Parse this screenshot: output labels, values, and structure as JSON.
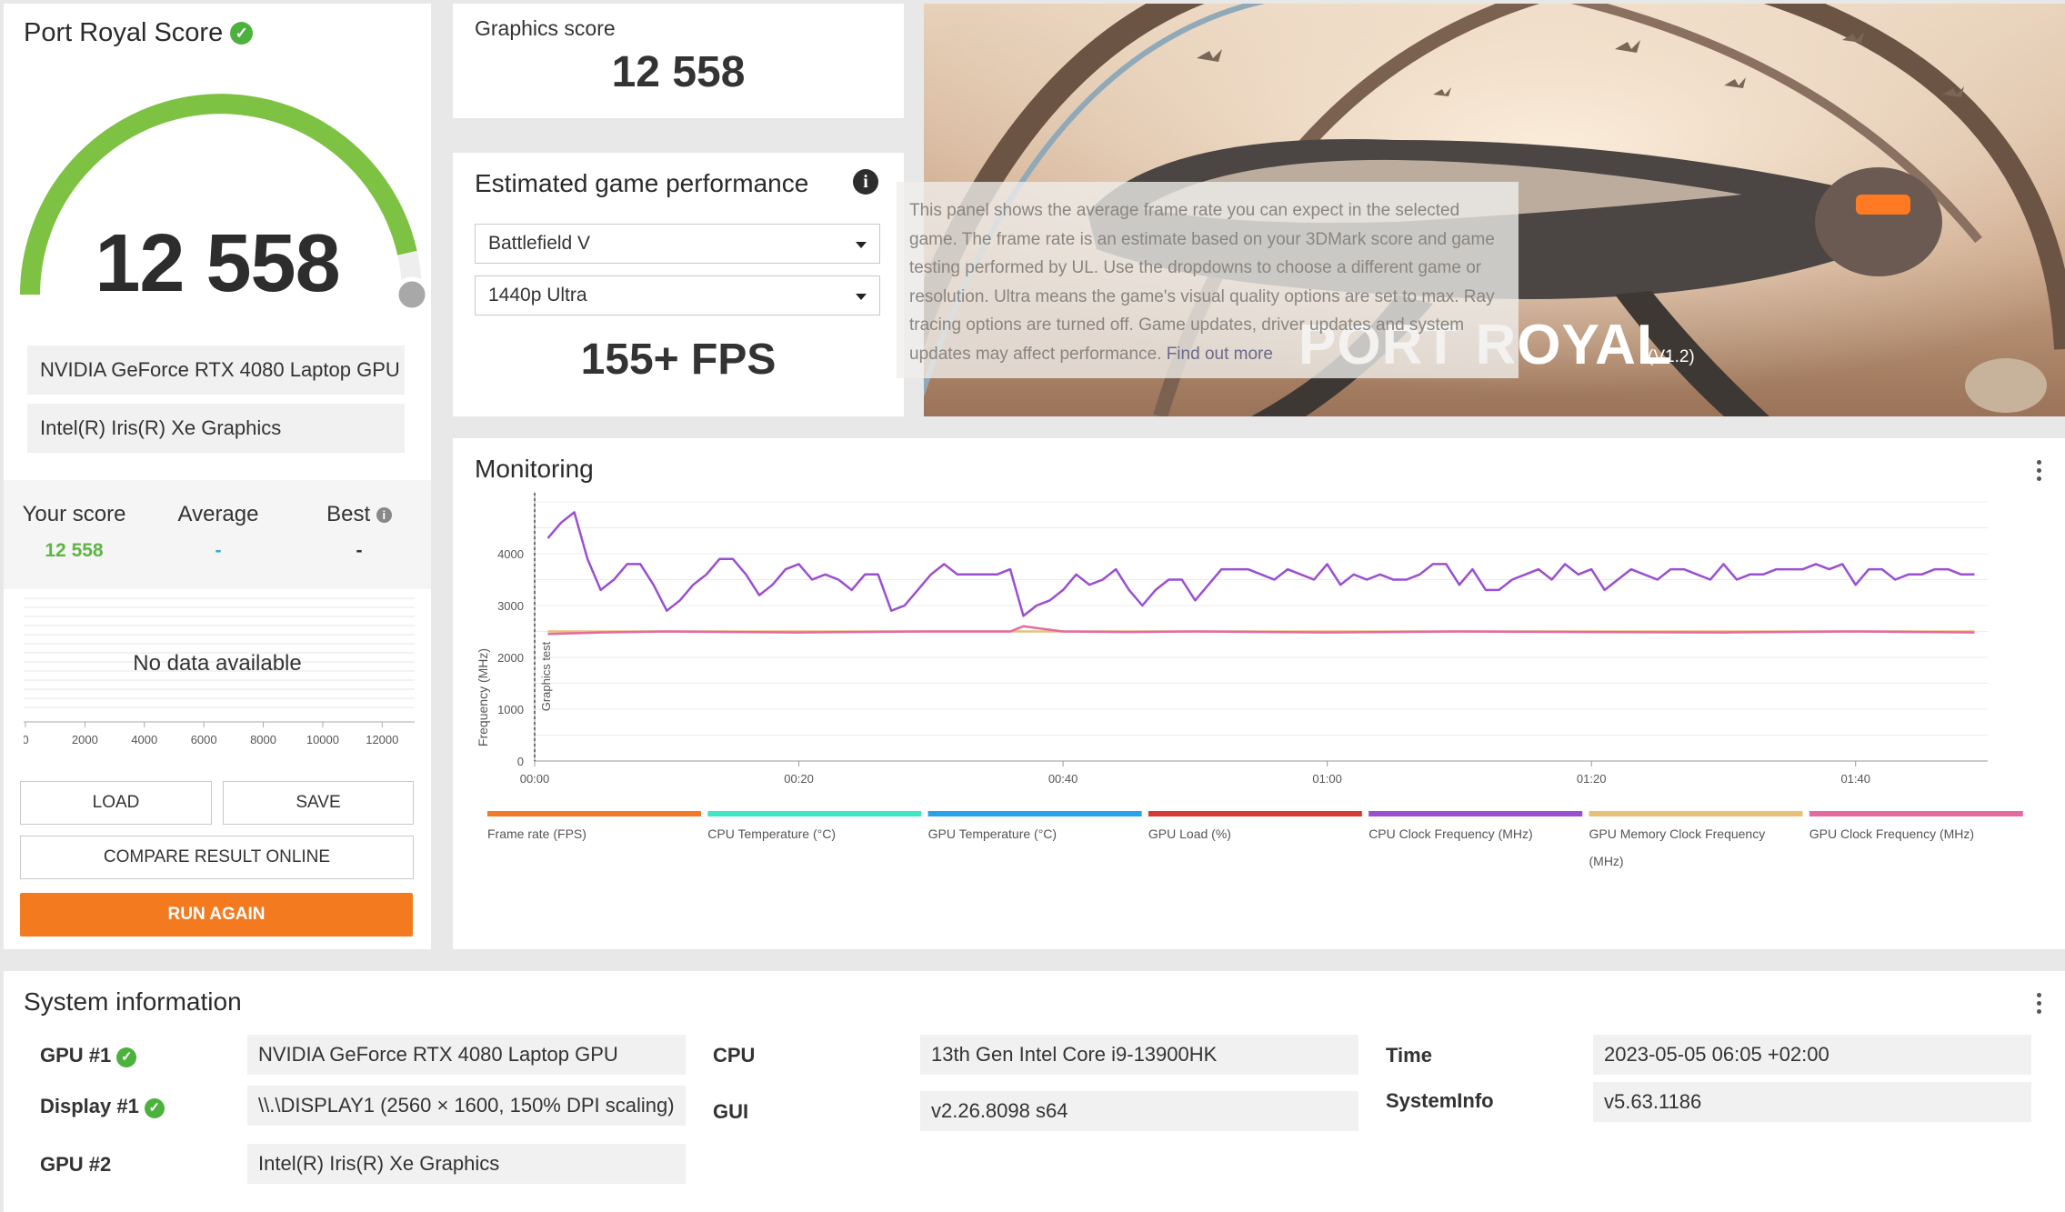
{
  "score_card": {
    "title": "Port Royal Score",
    "score": "12 558",
    "score_value": 12558,
    "gauge_fraction": 0.93,
    "gpus": [
      "NVIDIA GeForce RTX 4080 Laptop GPU",
      "Intel(R) Iris(R) Xe Graphics"
    ],
    "stats": {
      "your_label": "Your score",
      "your_value": "12 558",
      "avg_label": "Average",
      "avg_value": "-",
      "best_label": "Best",
      "best_value": "-"
    },
    "no_data": "No data available",
    "axis_ticks": [
      "0",
      "2000",
      "4000",
      "6000",
      "8000",
      "10000",
      "12000"
    ],
    "load_label": "LOAD",
    "save_label": "SAVE",
    "compare_label": "COMPARE RESULT ONLINE",
    "run_again_label": "RUN AGAIN",
    "colors": {
      "gauge": "#7dc242",
      "accent": "#f47a20",
      "your_score": "#5fb544",
      "average": "#3aa6d8"
    }
  },
  "graphics": {
    "label": "Graphics score",
    "value": "12 558"
  },
  "egp": {
    "title": "Estimated game performance",
    "game": "Battlefield V",
    "preset": "1440p Ultra",
    "fps": "155+ FPS",
    "tooltip": "This panel shows the average frame rate you can expect in the selected game. The frame rate is an estimate based on your 3DMark score and game testing performed by UL. Use the dropdowns to choose a different game or resolution. Ultra means the game's visual quality options are set to max. Ray tracing options are turned off. Game updates, driver updates and system updates may affect performance.",
    "tooltip_link": "Find out more"
  },
  "banner": {
    "title": "PORT ROYAL",
    "version": "(V1.2)"
  },
  "monitoring": {
    "title": "Monitoring",
    "chart_data": {
      "type": "line",
      "ylabel": "Frequency (MHz)",
      "ylim": [
        0,
        5000
      ],
      "yticks": [
        "0",
        "1000",
        "2000",
        "3000",
        "4000"
      ],
      "xlim": [
        0,
        110
      ],
      "xticks": [
        "00:00",
        "00:20",
        "00:40",
        "01:00",
        "01:20",
        "01:40"
      ],
      "annotation": "Graphics test",
      "series": [
        {
          "name": "CPU Clock Frequency (MHz)",
          "color": "#9a4fd0",
          "x": [
            1,
            2,
            3,
            4,
            5,
            6,
            7,
            8,
            9,
            10,
            11,
            12,
            13,
            14,
            15,
            16,
            17,
            18,
            19,
            20,
            21,
            22,
            23,
            24,
            25,
            26,
            27,
            28,
            29,
            30,
            31,
            32,
            33,
            34,
            35,
            36,
            37,
            38,
            39,
            40,
            41,
            42,
            43,
            44,
            45,
            46,
            47,
            48,
            49,
            50,
            51,
            52,
            53,
            54,
            55,
            56,
            57,
            58,
            59,
            60,
            61,
            62,
            63,
            64,
            65,
            66,
            67,
            68,
            69,
            70,
            71,
            72,
            73,
            74,
            75,
            76,
            77,
            78,
            79,
            80,
            81,
            82,
            83,
            84,
            85,
            86,
            87,
            88,
            89,
            90,
            91,
            92,
            93,
            94,
            95,
            96,
            97,
            98,
            99,
            100,
            101,
            102,
            103,
            104,
            105,
            106,
            107,
            108,
            109
          ],
          "values": [
            4300,
            4600,
            4800,
            3900,
            3300,
            3500,
            3800,
            3800,
            3400,
            2900,
            3100,
            3400,
            3600,
            3900,
            3900,
            3600,
            3200,
            3400,
            3700,
            3800,
            3500,
            3600,
            3500,
            3300,
            3600,
            3600,
            2900,
            3000,
            3300,
            3600,
            3800,
            3600,
            3600,
            3600,
            3600,
            3700,
            2800,
            3000,
            3100,
            3300,
            3600,
            3400,
            3500,
            3700,
            3300,
            3000,
            3300,
            3500,
            3500,
            3100,
            3400,
            3700,
            3700,
            3700,
            3600,
            3500,
            3700,
            3600,
            3500,
            3800,
            3400,
            3600,
            3500,
            3600,
            3500,
            3500,
            3600,
            3800,
            3800,
            3400,
            3700,
            3300,
            3300,
            3500,
            3600,
            3700,
            3500,
            3800,
            3600,
            3700,
            3300,
            3500,
            3700,
            3600,
            3500,
            3700,
            3700,
            3600,
            3500,
            3800,
            3500,
            3600,
            3600,
            3700,
            3700,
            3700,
            3800,
            3700,
            3800,
            3400,
            3700,
            3700,
            3500,
            3600,
            3600,
            3700,
            3700,
            3600,
            3600
          ]
        },
        {
          "name": "GPU Clock Frequency (MHz)",
          "color": "#e56aa2",
          "x": [
            1,
            5,
            10,
            20,
            30,
            36,
            37,
            40,
            45,
            50,
            60,
            70,
            80,
            90,
            100,
            109
          ],
          "values": [
            2450,
            2480,
            2500,
            2480,
            2500,
            2500,
            2600,
            2500,
            2490,
            2500,
            2480,
            2500,
            2490,
            2480,
            2500,
            2480
          ]
        },
        {
          "name": "GPU Memory Clock Frequency (MHz)",
          "color": "#e8c078",
          "x": [
            1,
            36,
            37,
            40,
            109
          ],
          "values": [
            2500,
            2500,
            2500,
            2500,
            2500
          ]
        }
      ],
      "legend": [
        {
          "name": "Frame rate (FPS)",
          "color": "#f07a2a"
        },
        {
          "name": "CPU Temperature (°C)",
          "color": "#3fe6c4"
        },
        {
          "name": "GPU Temperature (°C)",
          "color": "#2aa2e8"
        },
        {
          "name": "GPU Load (%)",
          "color": "#d83a3a"
        },
        {
          "name": "CPU Clock Frequency (MHz)",
          "color": "#9a4fd0"
        },
        {
          "name": "GPU Memory Clock Frequency (MHz)",
          "color": "#e8c078"
        },
        {
          "name": "GPU Clock Frequency (MHz)",
          "color": "#e56aa2"
        }
      ]
    }
  },
  "system": {
    "title": "System information",
    "gpu1_label": "GPU #1",
    "gpu1_value": "NVIDIA GeForce RTX 4080 Laptop GPU",
    "display1_label": "Display #1",
    "display1_value": "\\\\.\\DISPLAY1 (2560 × 1600, 150% DPI scaling)",
    "gpu2_label": "GPU #2",
    "gpu2_value": "Intel(R) Iris(R) Xe Graphics",
    "cpu_label": "CPU",
    "cpu_value": "13th Gen Intel Core i9-13900HK",
    "gui_label": "GUI",
    "gui_value": "v2.26.8098 s64",
    "time_label": "Time",
    "time_value": "2023-05-05 06:05 +02:00",
    "sysinfo_label": "SystemInfo",
    "sysinfo_value": "v5.63.1186"
  }
}
